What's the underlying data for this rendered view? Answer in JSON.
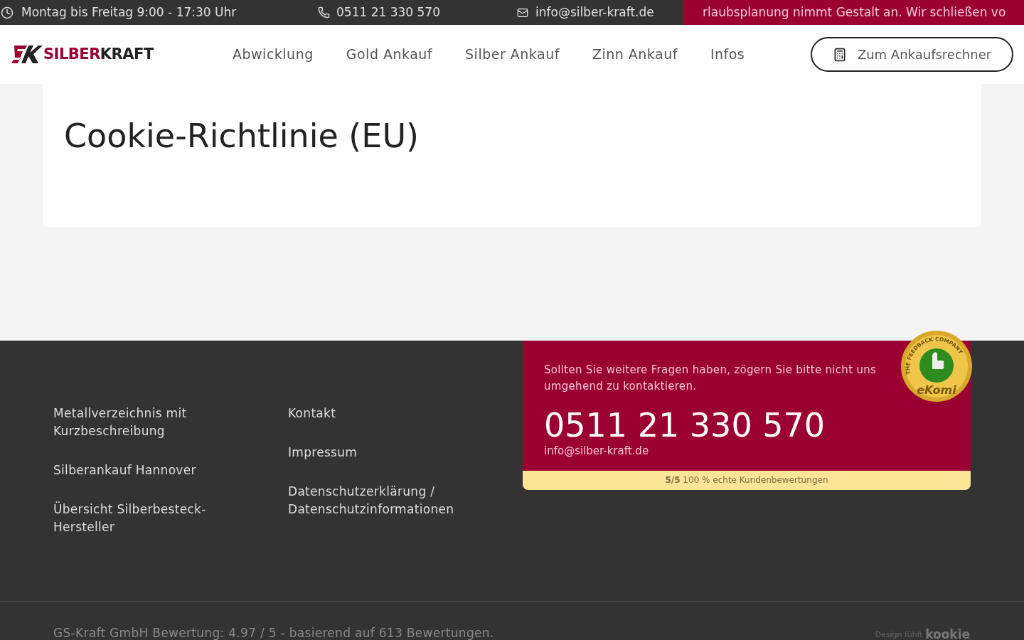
{
  "topbar": {
    "hours": "Montag bis Freitag 9:00 - 17:30 Uhr",
    "phone": "0511 21 330 570",
    "email": "info@silber-kraft.de",
    "ticker": "rlaubsplanung nimmt Gestalt an. Wir schließen vo"
  },
  "header": {
    "logo": {
      "part_1": "SILBER",
      "part_2": "KRAFT"
    },
    "nav": [
      {
        "label": "Abwicklung"
      },
      {
        "label": "Gold Ankauf"
      },
      {
        "label": "Silber Ankauf"
      },
      {
        "label": "Zinn Ankauf"
      },
      {
        "label": "Infos"
      }
    ],
    "cta": "Zum Ankaufsrechner"
  },
  "content": {
    "title": "Cookie-Richtlinie (EU)"
  },
  "footer": {
    "columns": [
      [
        "Metallverzeichnis mit Kurzbeschreibung",
        "Silberankauf Hannover",
        "Übersicht Silberbesteck-Hersteller"
      ],
      [
        "Kontakt",
        "Impressum",
        "Datenschutzerklärung / Datenschutzinformationen"
      ]
    ],
    "contact": {
      "text": "Sollten Sie weitere Fragen haben, zögern Sie bitte nicht uns umgehend zu kontaktieren.",
      "phone": "0511 21 330 570",
      "email": "info@silber-kraft.de",
      "rating": "**5/5** 100 % echte Kundenbewertungen"
    },
    "badge": {
      "arc": "THE FEEDBACK COMPANY",
      "name": "eKomi"
    },
    "bottom": {
      "rating": "GS-Kraft GmbH Bewertung: 4.97 / 5 - basierend auf 613 Bewertungen.",
      "credit": "Design fühlt",
      "brand": "kookie"
    }
  }
}
